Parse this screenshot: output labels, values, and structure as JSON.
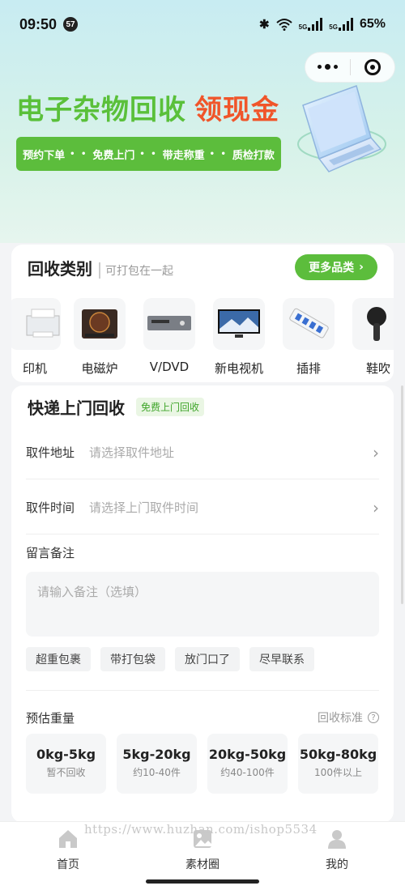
{
  "status_bar": {
    "time": "09:50",
    "notification_count": "57",
    "battery": "65%",
    "net1": "5G",
    "net2": "5G"
  },
  "hero": {
    "title_green": "电子杂物回收",
    "title_red": "领现金",
    "steps": [
      "预约下单",
      "免费上门",
      "带走称重",
      "质检打款"
    ],
    "separator": "• •"
  },
  "categories": {
    "title": "回收类别",
    "subtitle": "可打包在一起",
    "more_label": "更多品类",
    "items": [
      {
        "label": "印机",
        "icon": "printer-image"
      },
      {
        "label": "电磁炉",
        "icon": "induction-cooker-image"
      },
      {
        "label": "V/DVD",
        "icon": "dvd-player-image"
      },
      {
        "label": "新电视机",
        "icon": "tv-image"
      },
      {
        "label": "插排",
        "icon": "power-strip-image"
      },
      {
        "label": "鞋吹",
        "icon": "hair-dryer-image"
      }
    ]
  },
  "pickup": {
    "title": "快递上门回收",
    "tag": "免费上门回收",
    "address_label": "取件地址",
    "address_placeholder": "请选择取件地址",
    "time_label": "取件时间",
    "time_placeholder": "请选择上门取件时间",
    "memo_label": "留言备注",
    "memo_placeholder": "请输入备注（选填）",
    "chips": [
      "超重包裹",
      "带打包袋",
      "放门口了",
      "尽早联系"
    ],
    "weight_label": "预估重量",
    "standard_label": "回收标准",
    "standard_icon": "?",
    "weights": [
      {
        "range": "0kg-5kg",
        "note": "暂不回收"
      },
      {
        "range": "5kg-20kg",
        "note": "约10-40件"
      },
      {
        "range": "20kg-50kg",
        "note": "约40-100件"
      },
      {
        "range": "50kg-80kg",
        "note": "100件以上"
      }
    ]
  },
  "tabbar": {
    "tabs": [
      {
        "label": "首页",
        "icon": "home-icon"
      },
      {
        "label": "素材圈",
        "icon": "gallery-icon"
      },
      {
        "label": "我的",
        "icon": "user-icon"
      }
    ]
  },
  "watermark": "https://www.huzhan.com/ishop5534",
  "colors": {
    "brand_green": "#5cbd3c",
    "accent_red": "#f0552a"
  }
}
